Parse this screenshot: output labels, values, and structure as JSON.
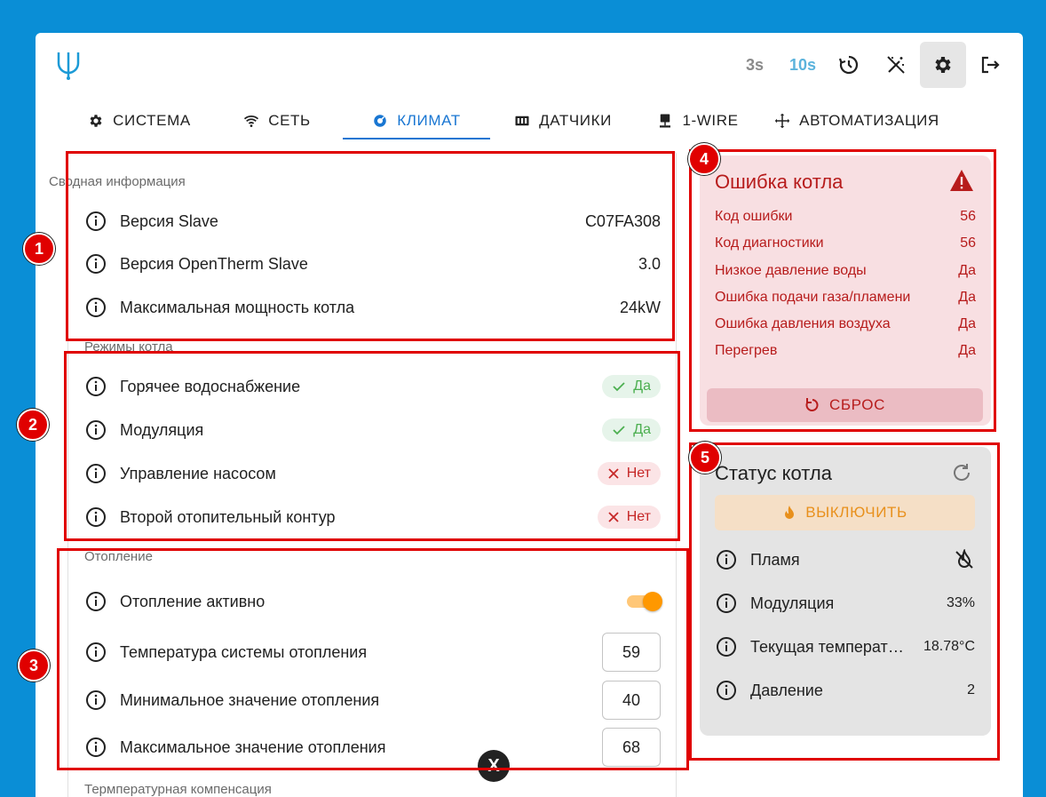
{
  "header": {
    "interval_3s": "3s",
    "interval_10s": "10s"
  },
  "tabs": [
    {
      "label": "СИСТЕМА",
      "icon": "gear-icon"
    },
    {
      "label": "СЕТЬ",
      "icon": "wifi-icon"
    },
    {
      "label": "КЛИМАТ",
      "icon": "climate-icon",
      "active": true
    },
    {
      "label": "ДАТЧИКИ",
      "icon": "sensors-icon"
    },
    {
      "label": "1-WIRE",
      "icon": "onewire-icon"
    },
    {
      "label": "АВТОМАТИЗАЦИЯ",
      "icon": "automation-icon"
    }
  ],
  "summary": {
    "title": "Сводная информация",
    "rows": [
      {
        "label": "Версия Slave",
        "value": "C07FA308"
      },
      {
        "label": "Версия OpenTherm Slave",
        "value": "3.0"
      },
      {
        "label": "Максимальная мощность котла",
        "value": "24kW"
      }
    ]
  },
  "modes": {
    "title": "Режимы котла",
    "rows": [
      {
        "label": "Горячее водоснабжение",
        "value": "Да",
        "state": "yes"
      },
      {
        "label": "Модуляция",
        "value": "Да",
        "state": "yes"
      },
      {
        "label": "Управление насосом",
        "value": "Нет",
        "state": "no"
      },
      {
        "label": "Второй отопительный контур",
        "value": "Нет",
        "state": "no"
      }
    ]
  },
  "heating": {
    "title": "Отопление",
    "active_label": "Отопление активно",
    "active": true,
    "rows": [
      {
        "label": "Температура системы отопления",
        "value": "59"
      },
      {
        "label": "Минимальное значение отопления",
        "value": "40"
      },
      {
        "label": "Максимальное значение отопления",
        "value": "68"
      }
    ]
  },
  "compensation": {
    "title": "Термпературная компенсация"
  },
  "boiler_error": {
    "title": "Ошибка котла",
    "rows": [
      {
        "label": "Код ошибки",
        "value": "56"
      },
      {
        "label": "Код диагностики",
        "value": "56"
      },
      {
        "label": "Низкое давление воды",
        "value": "Да"
      },
      {
        "label": "Ошибка подачи газа/пламени",
        "value": "Да"
      },
      {
        "label": "Ошибка давления воздуха",
        "value": "Да"
      },
      {
        "label": "Перегрев",
        "value": "Да"
      }
    ],
    "reset_label": "СБРОС",
    "color": "#b71c1c"
  },
  "boiler_status": {
    "title": "Статус котла",
    "off_button": "ВЫКЛЮЧИТЬ",
    "rows": [
      {
        "label": "Пламя",
        "value": "",
        "icon": "flame-off-icon"
      },
      {
        "label": "Модуляция",
        "value": "33%"
      },
      {
        "label": "Текущая температура",
        "value": "18.78°C"
      },
      {
        "label": "Давление",
        "value": "2"
      }
    ]
  },
  "annotations": [
    "1",
    "2",
    "3",
    "4",
    "5"
  ],
  "fab_label": "X"
}
